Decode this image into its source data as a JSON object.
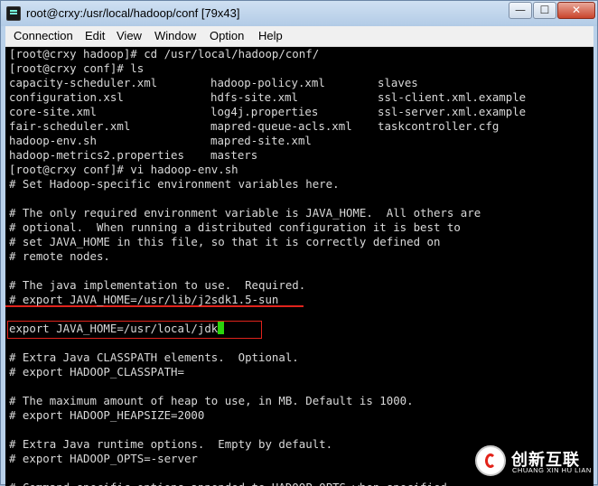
{
  "window": {
    "title": "root@crxy:/usr/local/hadoop/conf [79x43]",
    "buttons": {
      "minimize": "—",
      "maximize": "☐",
      "close": "✕"
    }
  },
  "menu": [
    "Connection",
    "Edit",
    "View",
    "Window",
    "Option",
    "Help"
  ],
  "terminal": {
    "lines": [
      "[root@crxy hadoop]# cd /usr/local/hadoop/conf/",
      "[root@crxy conf]# ls",
      [
        "capacity-scheduler.xml",
        "hadoop-policy.xml",
        "slaves"
      ],
      [
        "configuration.xsl",
        "hdfs-site.xml",
        "ssl-client.xml.example"
      ],
      [
        "core-site.xml",
        "log4j.properties",
        "ssl-server.xml.example"
      ],
      [
        "fair-scheduler.xml",
        "mapred-queue-acls.xml",
        "taskcontroller.cfg"
      ],
      [
        "hadoop-env.sh",
        "mapred-site.xml",
        ""
      ],
      [
        "hadoop-metrics2.properties",
        "masters",
        ""
      ],
      "[root@crxy conf]# vi hadoop-env.sh",
      "# Set Hadoop-specific environment variables here.",
      "",
      "# The only required environment variable is JAVA_HOME.  All others are",
      "# optional.  When running a distributed configuration it is best to",
      "# set JAVA_HOME in this file, so that it is correctly defined on",
      "# remote nodes.",
      "",
      "# The java implementation to use.  Required.",
      "# export JAVA_HOME=/usr/lib/j2sdk1.5-sun",
      "",
      "export JAVA_HOME=/usr/local/jdk",
      "",
      "# Extra Java CLASSPATH elements.  Optional.",
      "# export HADOOP_CLASSPATH=",
      "",
      "# The maximum amount of heap to use, in MB. Default is 1000.",
      "# export HADOOP_HEAPSIZE=2000",
      "",
      "# Extra Java runtime options.  Empty by default.",
      "# export HADOOP_OPTS=-server",
      "",
      "# Command specific options appended to HADOOP_OPTS when specified"
    ]
  },
  "watermark": {
    "cn": "创新互联",
    "en": "CHUANG XIN HU LIAN"
  },
  "colors": {
    "annotation": "#e0231c",
    "cursor": "#2bd40c",
    "text": "#d9d9d9"
  }
}
